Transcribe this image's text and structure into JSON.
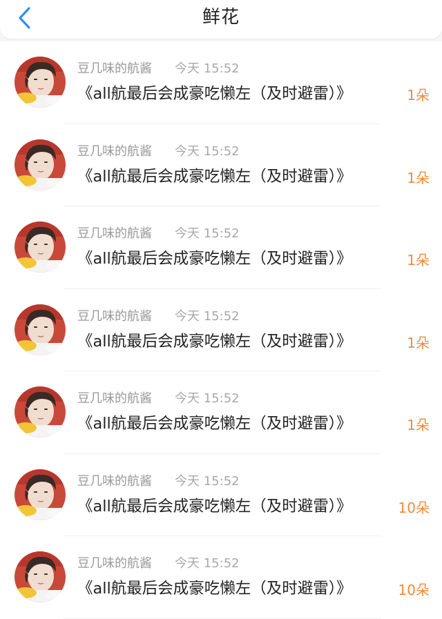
{
  "header": {
    "title": "鲜花",
    "back_icon": "chevron-left-icon",
    "accent_color": "#2f8ff0"
  },
  "records": [
    {
      "name": "豆几味的航酱",
      "time": "今天 15:52",
      "work": "《all航最后会成豪吃懒左（及时避雷）》",
      "count": "1朵"
    },
    {
      "name": "豆几味的航酱",
      "time": "今天 15:52",
      "work": "《all航最后会成豪吃懒左（及时避雷）》",
      "count": "1朵"
    },
    {
      "name": "豆几味的航酱",
      "time": "今天 15:52",
      "work": "《all航最后会成豪吃懒左（及时避雷）》",
      "count": "1朵"
    },
    {
      "name": "豆几味的航酱",
      "time": "今天 15:52",
      "work": "《all航最后会成豪吃懒左（及时避雷）》",
      "count": "1朵"
    },
    {
      "name": "豆几味的航酱",
      "time": "今天 15:52",
      "work": "《all航最后会成豪吃懒左（及时避雷）》",
      "count": "1朵"
    },
    {
      "name": "豆几味的航酱",
      "time": "今天 15:52",
      "work": "《all航最后会成豪吃懒左（及时避雷）》",
      "count": "10朵"
    },
    {
      "name": "豆几味的航酱",
      "time": "今天 15:52",
      "work": "《all航最后会成豪吃懒左（及时避雷）》",
      "count": "10朵"
    }
  ],
  "colors": {
    "count": "#f08a3c",
    "name": "#9a9a9a",
    "work": "#222222"
  }
}
